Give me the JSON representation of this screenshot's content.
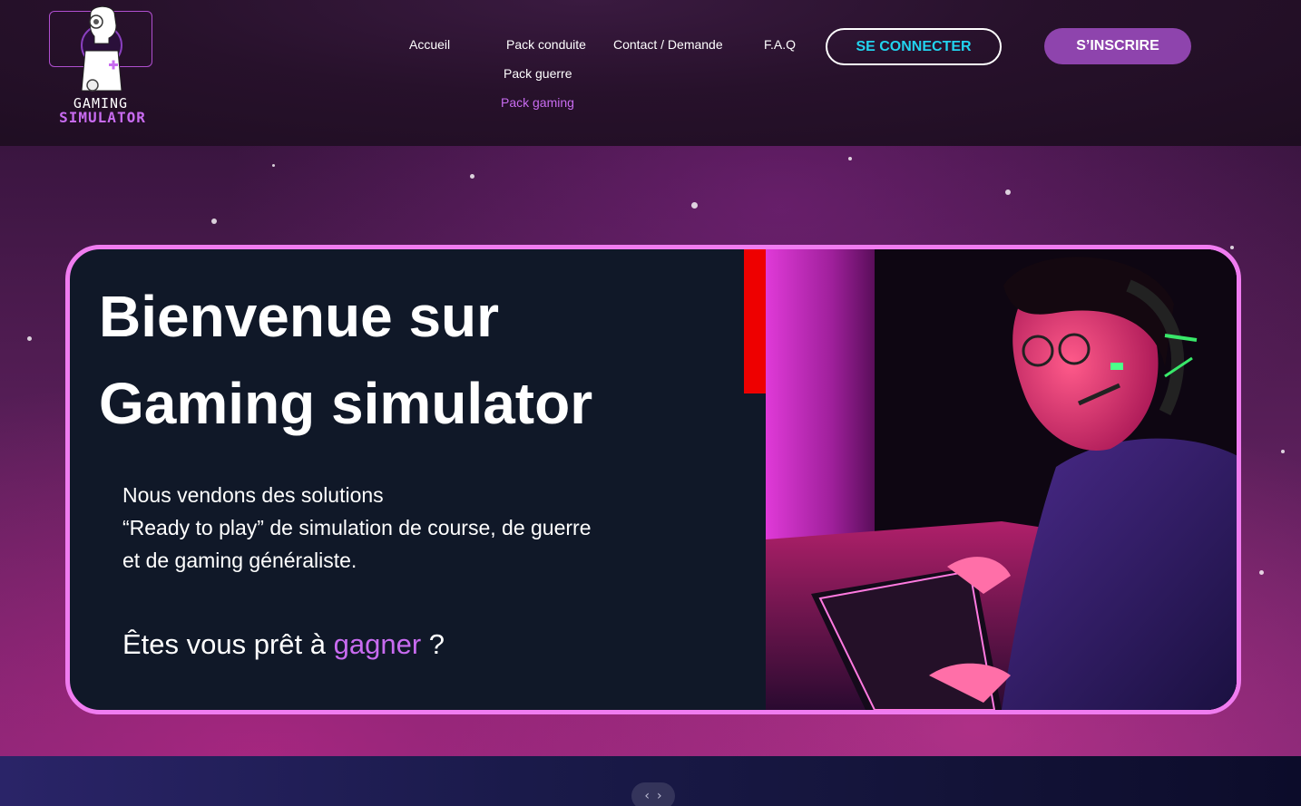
{
  "logo": {
    "line1": "GAMING",
    "line2": "SIMULATOR"
  },
  "nav": {
    "home": "Accueil",
    "pack_driving": "Pack conduite",
    "pack_war": "Pack guerre",
    "pack_gaming": "Pack gaming",
    "contact": "Contact / Demande",
    "faq": "F.A.Q"
  },
  "buttons": {
    "login": "SE CONNECTER",
    "register": "S’INSCRIRE"
  },
  "hero": {
    "title_line1": "Bienvenue sur",
    "title_line2": "Gaming simulator",
    "text_line1": "Nous vendons des solutions",
    "text_line2": "“Ready to play” de simulation de course, de guerre",
    "text_line3": "et de gaming généraliste.",
    "question_before": "Êtes vous prêt à ",
    "question_accent": "gagner",
    "question_after": " ?"
  },
  "carousel": {
    "prev_icon": "chevron-left-icon",
    "next_icon": "chevron-right-icon"
  },
  "colors": {
    "accent_purple": "#c86bf0",
    "button_purple": "#8e44ad",
    "login_text_cyan": "#22d3ee",
    "hero_border": "#f07cf0",
    "hero_background": "#101828"
  }
}
